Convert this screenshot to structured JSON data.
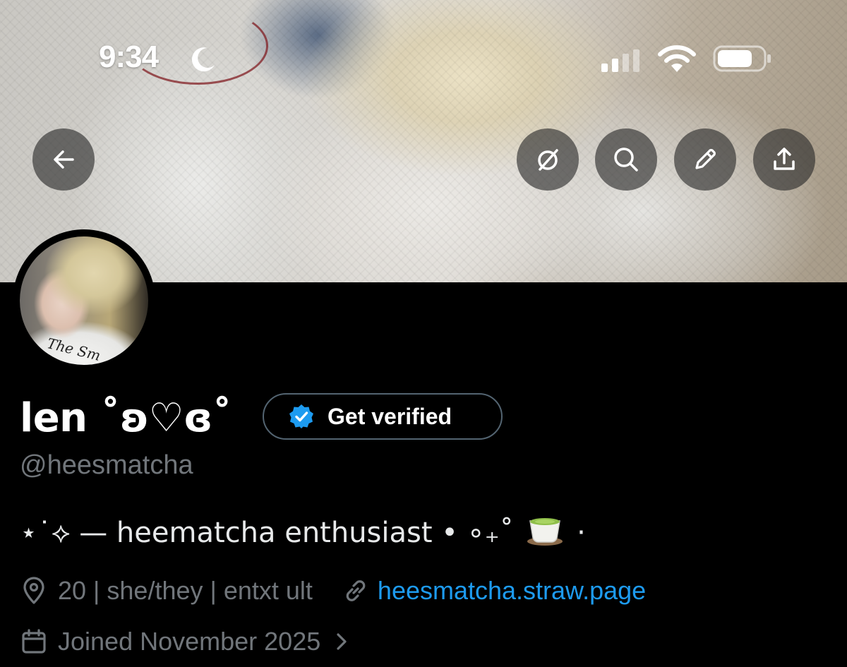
{
  "status_bar": {
    "time": "9:34",
    "icons": [
      "moon-icon",
      "signal-icon",
      "wifi-icon",
      "battery-icon"
    ]
  },
  "header": {
    "buttons": [
      "back-arrow-icon",
      "grok-icon",
      "search-icon",
      "pencil-icon",
      "share-icon"
    ]
  },
  "profile": {
    "display_name": "len ˚ʚ♡ɞ˚",
    "get_verified_label": "Get verified",
    "handle": "@heesmatcha",
    "bio_text": "⋆˙⟡ — heematcha enthusiast • ∘₊˚",
    "bio_tail": "·",
    "bio_emoji": "teacup-emoji",
    "location": "20 | she/they | entxt ult",
    "website": "heesmatcha.straw.page",
    "joined": "Joined November 2025"
  },
  "colors": {
    "background": "#000000",
    "primary_text": "#e7e9ea",
    "secondary_text": "#71767b",
    "link": "#1d9bf0",
    "verified_badge": "#1d9bf0",
    "button_border": "#536471"
  }
}
